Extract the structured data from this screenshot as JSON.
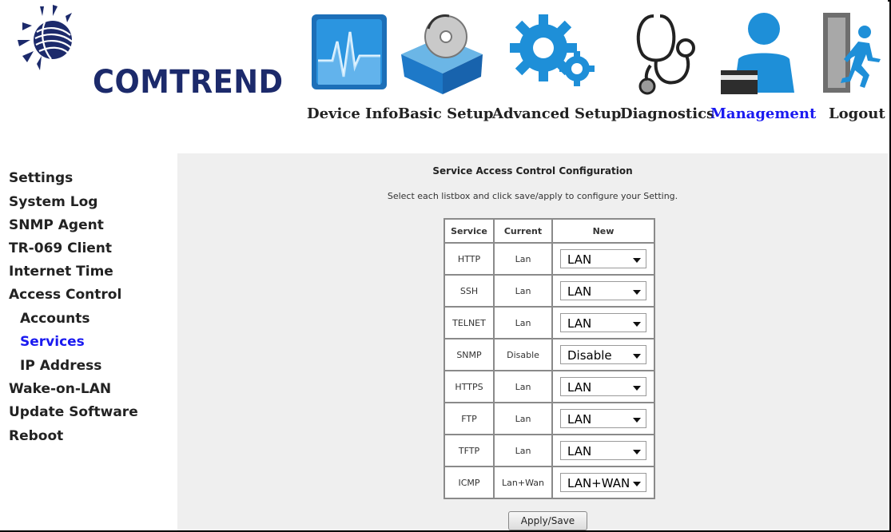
{
  "brand": {
    "name": "COMTREND"
  },
  "nav": [
    {
      "label": "Device Info",
      "icon": "monitor-graph-icon"
    },
    {
      "label": "Basic Setup",
      "icon": "box-disc-icon"
    },
    {
      "label": "Advanced Setup",
      "icon": "gears-icon"
    },
    {
      "label": "Diagnostics",
      "icon": "stethoscope-icon"
    },
    {
      "label": "Management",
      "icon": "user-card-icon",
      "active": true
    },
    {
      "label": "Logout",
      "icon": "exit-door-icon"
    }
  ],
  "sidebar": {
    "items": [
      {
        "label": "Settings"
      },
      {
        "label": "System Log"
      },
      {
        "label": "SNMP Agent"
      },
      {
        "label": "TR-069 Client"
      },
      {
        "label": "Internet Time"
      },
      {
        "label": "Access Control"
      },
      {
        "label": "Accounts",
        "sub": true
      },
      {
        "label": "Services",
        "sub": true,
        "active": true
      },
      {
        "label": "IP Address",
        "sub": true
      },
      {
        "label": "Wake-on-LAN"
      },
      {
        "label": "Update Software"
      },
      {
        "label": "Reboot"
      }
    ]
  },
  "main": {
    "title": "Service Access Control Configuration",
    "description": "Select each listbox and click save/apply to configure your Setting.",
    "table": {
      "headers": [
        "Service",
        "Current",
        "New"
      ],
      "rows": [
        {
          "service": "HTTP",
          "current": "Lan",
          "new": "LAN"
        },
        {
          "service": "SSH",
          "current": "Lan",
          "new": "LAN"
        },
        {
          "service": "TELNET",
          "current": "Lan",
          "new": "LAN"
        },
        {
          "service": "SNMP",
          "current": "Disable",
          "new": "Disable"
        },
        {
          "service": "HTTPS",
          "current": "Lan",
          "new": "LAN"
        },
        {
          "service": "FTP",
          "current": "Lan",
          "new": "LAN"
        },
        {
          "service": "TFTP",
          "current": "Lan",
          "new": "LAN"
        },
        {
          "service": "ICMP",
          "current": "Lan+Wan",
          "new": "LAN+WAN"
        }
      ]
    },
    "apply_label": "Apply/Save"
  },
  "colors": {
    "active_link": "#1a1af0",
    "content_bg": "#efefef",
    "brand_navy": "#1c2a6b",
    "icon_blue": "#1e8fd8"
  }
}
